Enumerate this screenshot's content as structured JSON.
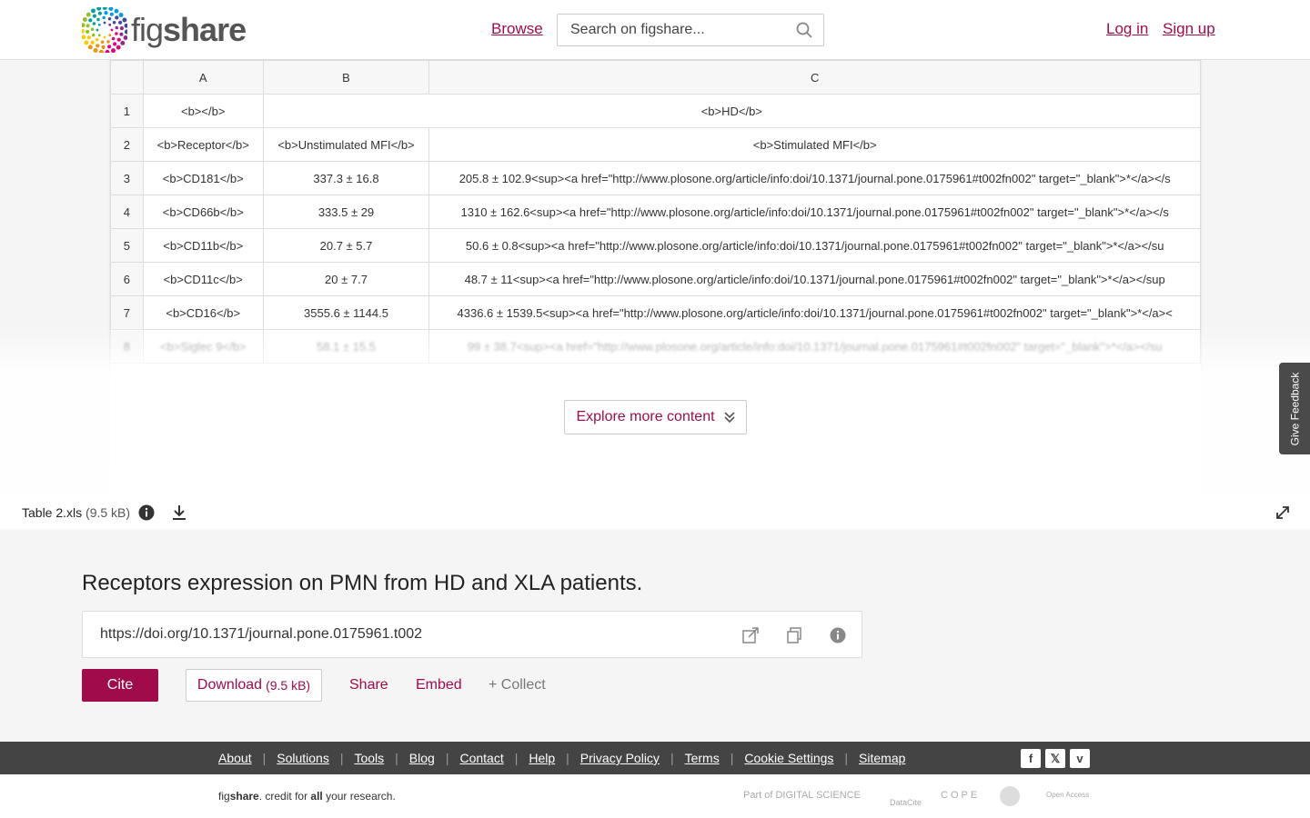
{
  "header": {
    "logo_text_light": "fig",
    "logo_text_bold": "share",
    "browse_label": "Browse",
    "search_placeholder": "Search on figshare...",
    "login_label": "Log in",
    "signup_label": "Sign up",
    "brand_color": "#a00c4b"
  },
  "spreadsheet": {
    "columns": [
      "A",
      "B",
      "C"
    ],
    "rows": [
      {
        "n": "1",
        "a": "<b></b>",
        "b": "<b>HD</b>",
        "c": null,
        "merge_bc": true
      },
      {
        "n": "2",
        "a": "<b>Receptor</b>",
        "b": "<b>Unstimulated MFI</b>",
        "c": "<b>Stimulated MFI</b>"
      },
      {
        "n": "3",
        "a": "<b>CD181</b>",
        "b": "337.3 ± 16.8",
        "c": "205.8 ± 102.9<sup><a href=\"http://www.plosone.org/article/info:doi/10.1371/journal.pone.0175961#t002fn002\" target=\"_blank\">*</a></s"
      },
      {
        "n": "4",
        "a": "<b>CD66b</b>",
        "b": "333.5 ± 29",
        "c": "1310 ± 162.6<sup><a href=\"http://www.plosone.org/article/info:doi/10.1371/journal.pone.0175961#t002fn002\" target=\"_blank\">*</a></s"
      },
      {
        "n": "5",
        "a": "<b>CD11b</b>",
        "b": "20.7 ± 5.7",
        "c": "50.6 ± 0.8<sup><a href=\"http://www.plosone.org/article/info:doi/10.1371/journal.pone.0175961#t002fn002\" target=\"_blank\">*</a></su"
      },
      {
        "n": "6",
        "a": "<b>CD11c</b>",
        "b": "20 ± 7.7",
        "c": "48.7 ± 11<sup><a href=\"http://www.plosone.org/article/info:doi/10.1371/journal.pone.0175961#t002fn002\" target=\"_blank\">*</a></sup"
      },
      {
        "n": "7",
        "a": "<b>CD16</b>",
        "b": "3555.6 ± 1144.5",
        "c": "4336.6 ± 1539.5<sup><a href=\"http://www.plosone.org/article/info:doi/10.1371/journal.pone.0175961#t002fn002\" target=\"_blank\">*</a><"
      },
      {
        "n": "8",
        "a": "<b>Siglec 9</b>",
        "b": "58.1 ± 15.5",
        "c": "99 ± 38.7<sup><a href=\"http://www.plosone.org/article/info:doi/10.1371/journal.pone.0175961#t002fn002\" target=\"_blank\">*</a></su",
        "faded": true
      }
    ]
  },
  "explore_label": "Explore more content",
  "feedback_label": "Give Feedback",
  "file": {
    "name": "Table 2.xls",
    "size": "(9.5 kB)"
  },
  "item": {
    "title": "Receptors expression on PMN from HD and XLA patients.",
    "doi": "https://doi.org/10.1371/journal.pone.0175961.t002"
  },
  "actions": {
    "cite": "Cite",
    "download": "Download",
    "download_size": "(9.5 kB)",
    "share": "Share",
    "embed": "Embed",
    "collect": "+ Collect"
  },
  "footer": {
    "links": [
      "About",
      "Solutions",
      "Tools",
      "Blog",
      "Contact",
      "Help",
      "Privacy Policy",
      "Terms",
      "Cookie Settings",
      "Sitemap"
    ],
    "social": [
      "facebook-icon",
      "x-icon",
      "vimeo-icon"
    ],
    "tagline_pre": "fig",
    "tagline_bold": "share",
    "tagline_mid": ". credit for ",
    "tagline_all": "all",
    "tagline_post": " your research.",
    "partners": [
      "Part of DIGITAL SCIENCE",
      "DataCite",
      "COPE",
      "Open Access"
    ]
  }
}
